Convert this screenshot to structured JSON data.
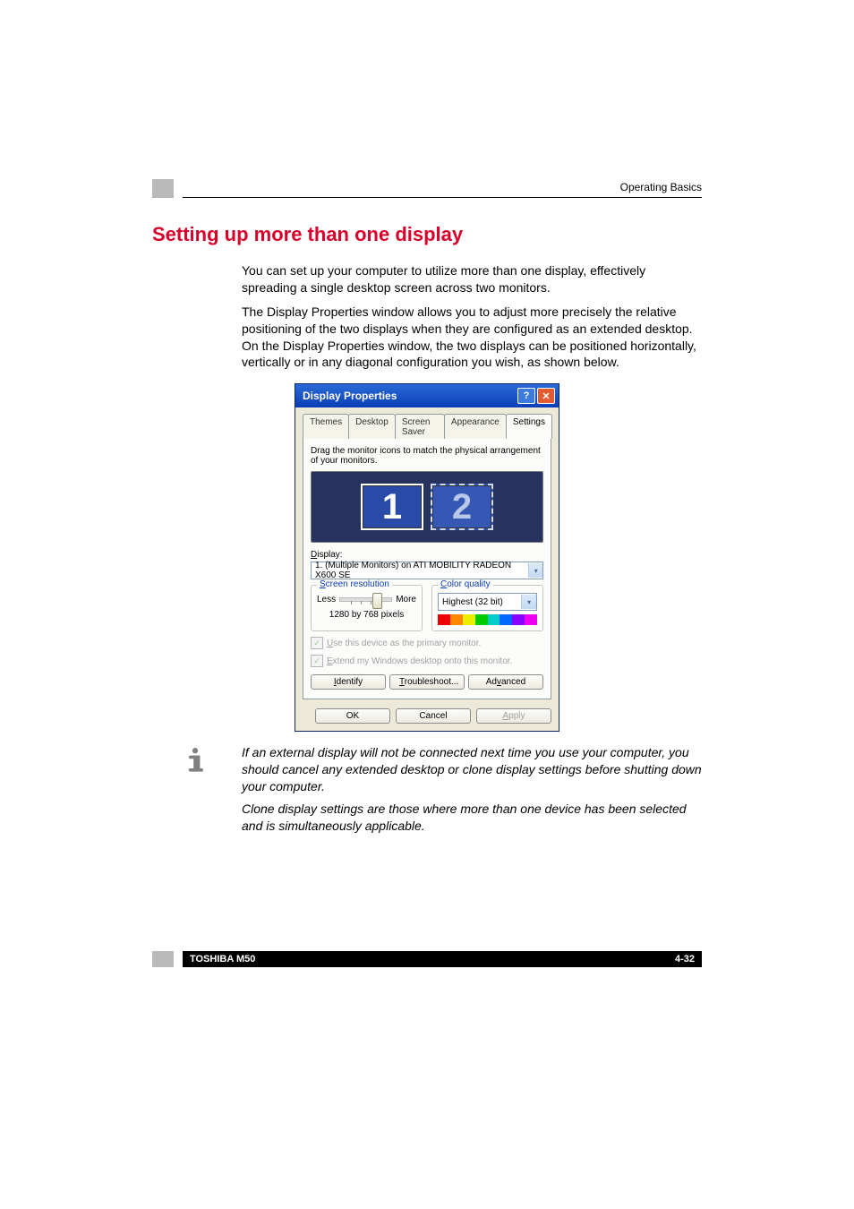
{
  "header": {
    "running_head": "Operating Basics"
  },
  "title": "Setting up more than one display",
  "paragraphs": [
    "You can set up your computer to utilize more than one display, effectively spreading a single desktop screen across two monitors.",
    "The Display Properties window allows you to adjust more precisely the relative positioning of the two displays when they are configured as an extended desktop. On the Display Properties window, the two displays can be positioned horizontally, vertically or in any diagonal configuration you wish, as shown below."
  ],
  "note": {
    "paragraphs": [
      "If an external display will not be connected next time you use your computer, you should cancel any extended desktop or clone display settings before shutting down your computer.",
      "Clone display settings are those where more than one device has been selected and is simultaneously applicable."
    ]
  },
  "footer": {
    "left": "TOSHIBA M50",
    "right": "4-32"
  },
  "dialog": {
    "title": "Display Properties",
    "tabs": [
      "Themes",
      "Desktop",
      "Screen Saver",
      "Appearance",
      "Settings"
    ],
    "active_tab_index": 4,
    "instruction": "Drag the monitor icons to match the physical arrangement of your monitors.",
    "monitors": {
      "primary": "1",
      "secondary": "2"
    },
    "display_label": "Display:",
    "display_value": "1. (Multiple Monitors) on ATI MOBILITY RADEON X600 SE",
    "screen_res": {
      "legend": "Screen resolution",
      "less": "Less",
      "more": "More",
      "value": "1280 by 768 pixels"
    },
    "color_quality": {
      "legend": "Color quality",
      "value": "Highest (32 bit)"
    },
    "checkboxes": {
      "primary": "Use this device as the primary monitor.",
      "extend": "Extend my Windows desktop onto this monitor."
    },
    "mid_buttons": {
      "identify": "Identify",
      "troubleshoot": "Troubleshoot...",
      "advanced": "Advanced"
    },
    "bottom_buttons": {
      "ok": "OK",
      "cancel": "Cancel",
      "apply": "Apply"
    }
  }
}
